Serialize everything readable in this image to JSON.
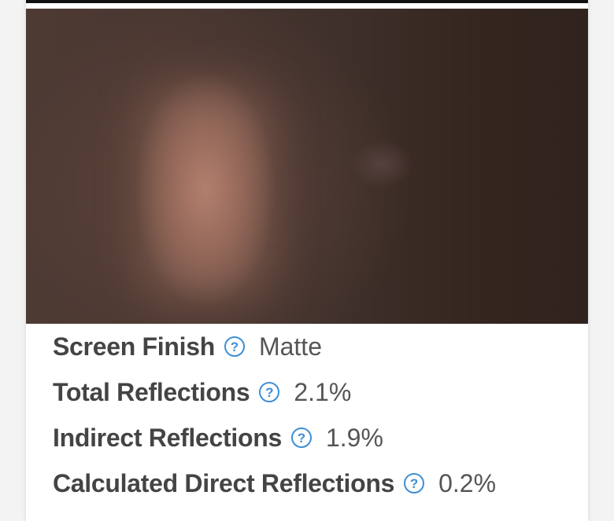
{
  "photo": {
    "description_icon": "reflection-photo"
  },
  "specs": [
    {
      "label": "Screen Finish",
      "value": "Matte",
      "icon": "help-icon"
    },
    {
      "label": "Total Reflections",
      "value": "2.1%",
      "icon": "help-icon"
    },
    {
      "label": "Indirect Reflections",
      "value": "1.9%",
      "icon": "help-icon"
    },
    {
      "label": "Calculated Direct Reflections",
      "value": "0.2%",
      "icon": "help-icon"
    }
  ],
  "help_glyph": "?",
  "colors": {
    "accent": "#3d8fd6",
    "label": "#444444",
    "value": "#555555"
  }
}
